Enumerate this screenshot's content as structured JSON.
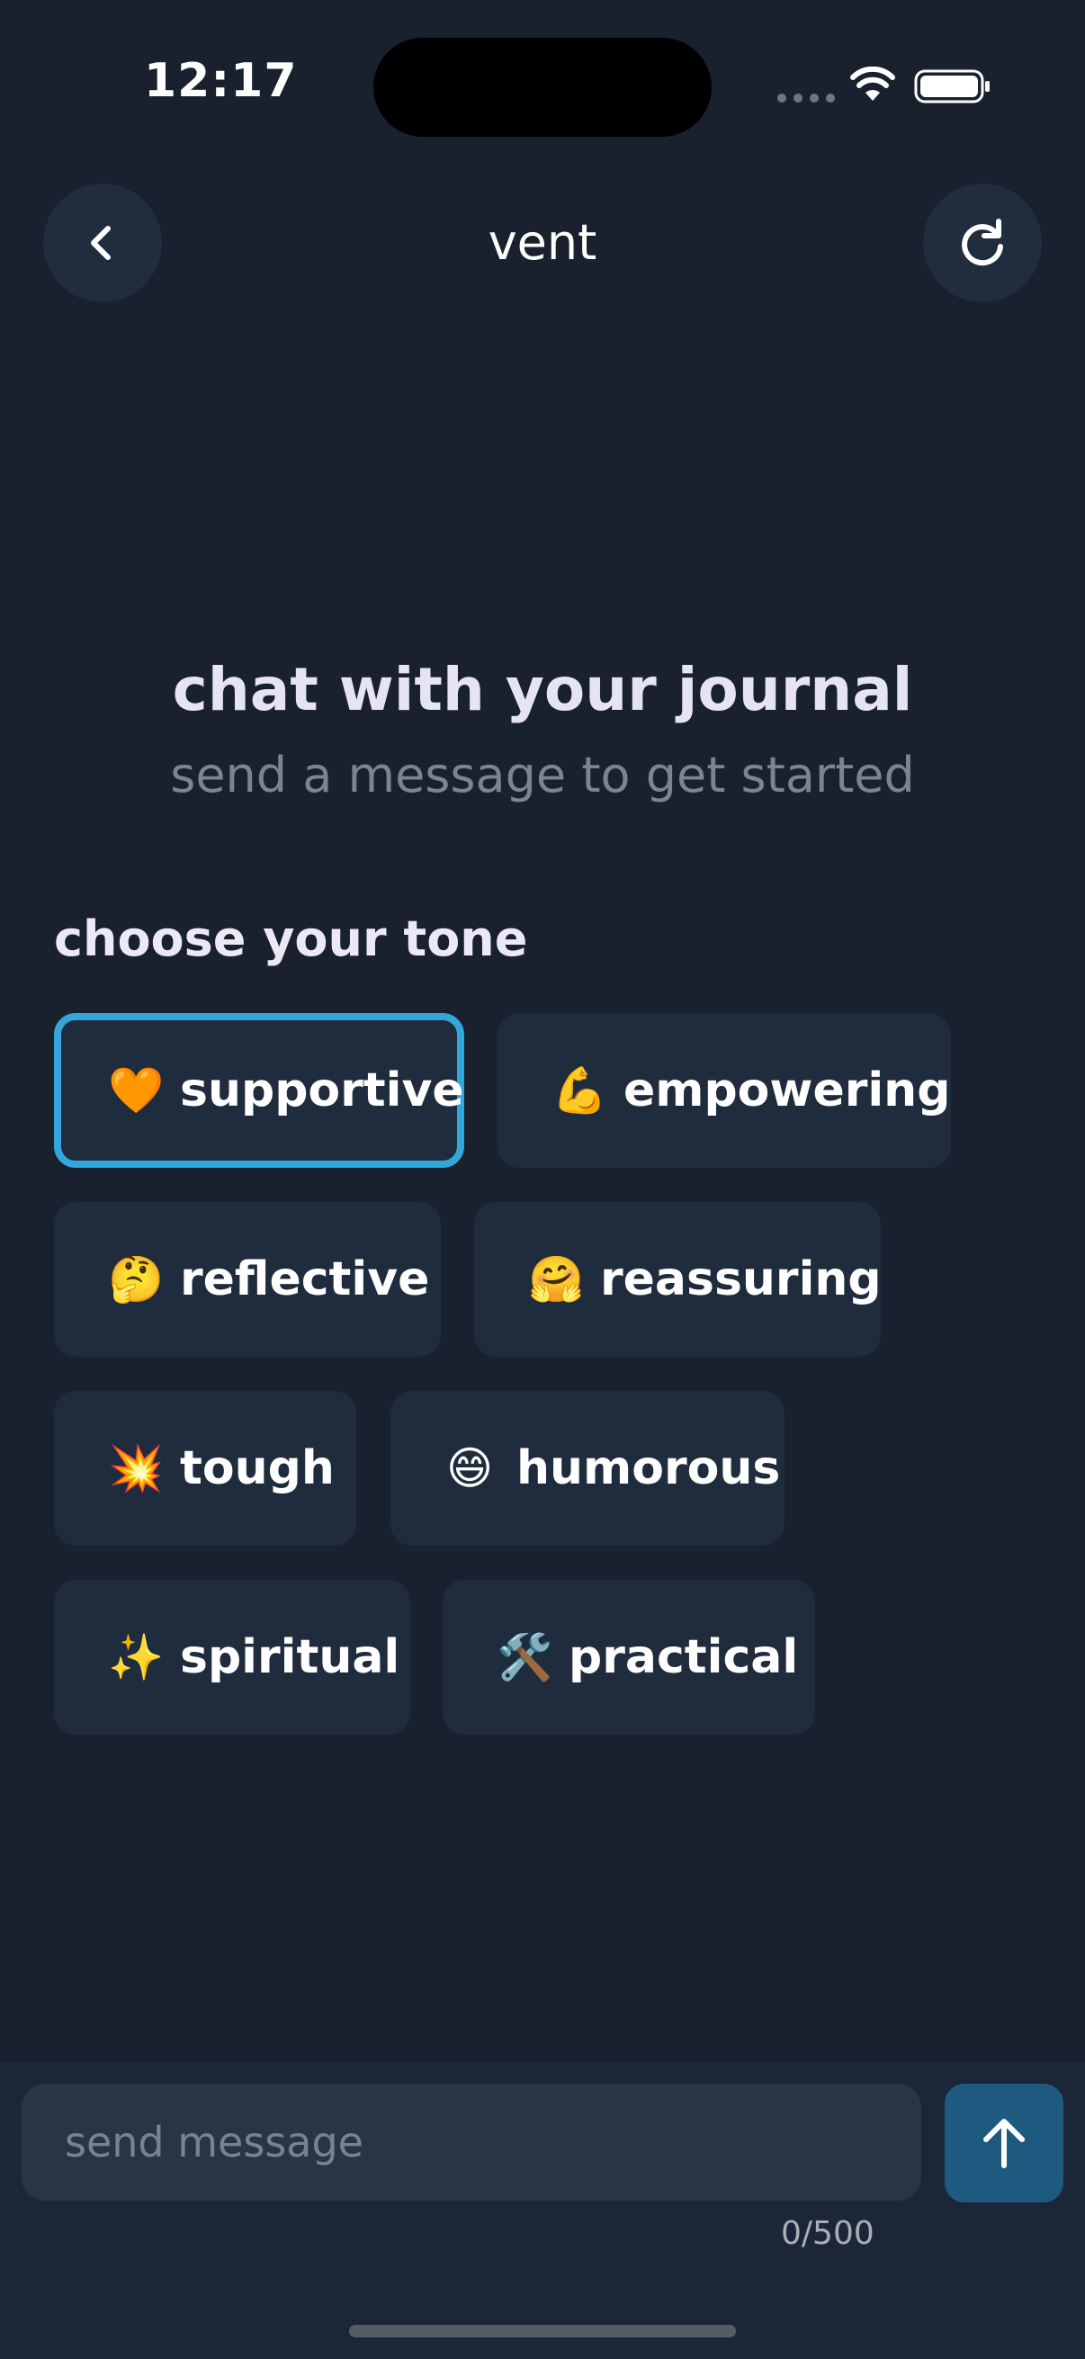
{
  "status_bar": {
    "time": "12:17"
  },
  "header": {
    "title": "vent",
    "back_icon": "chevron-left-icon",
    "refresh_icon": "refresh-icon"
  },
  "empty_state": {
    "title": "chat with your journal",
    "subtitle": "send a message to get started"
  },
  "tone": {
    "label": "choose your tone",
    "selected": "supportive",
    "options": [
      {
        "emoji": "🧡",
        "label": "supportive"
      },
      {
        "emoji": "💪",
        "label": "empowering"
      },
      {
        "emoji": "🤔",
        "label": "reflective"
      },
      {
        "emoji": "🤗",
        "label": "reassuring"
      },
      {
        "emoji": "💥",
        "label": "tough"
      },
      {
        "emoji": "😄",
        "label": "humorous"
      },
      {
        "emoji": "✨",
        "label": "spiritual"
      },
      {
        "emoji": "🛠️",
        "label": "practical"
      }
    ]
  },
  "composer": {
    "placeholder": "send message",
    "value": "",
    "char_count": "0/500",
    "send_icon": "arrow-up-icon"
  },
  "colors": {
    "background": "#18212d",
    "accent": "#34a6dc",
    "chip": "#1f2c3e",
    "send_button": "#1e5a7f"
  }
}
